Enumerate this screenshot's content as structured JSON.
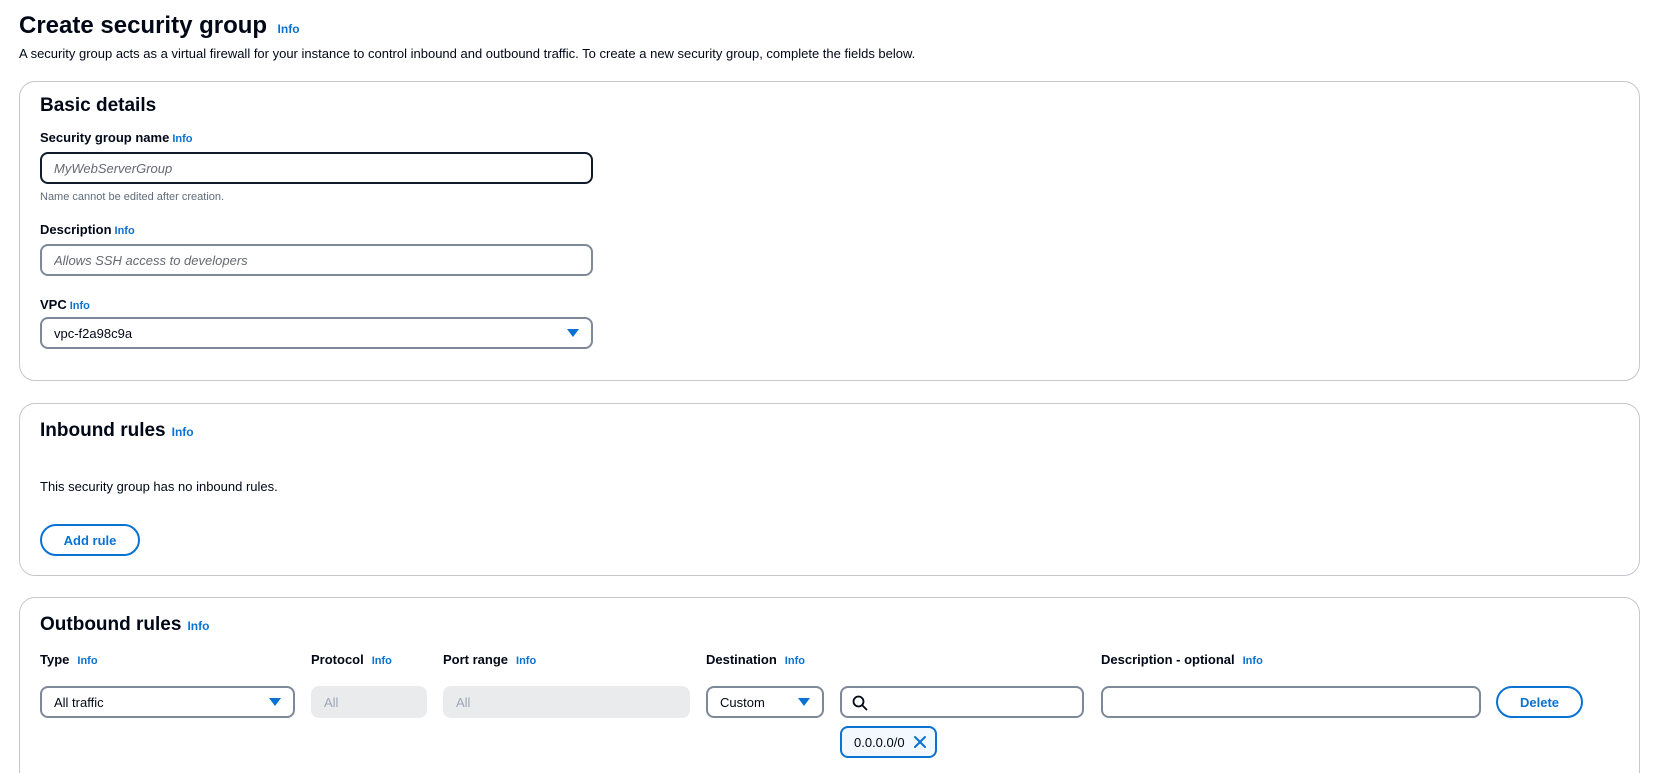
{
  "header": {
    "title": "Create security group",
    "info": "Info",
    "description": "A security group acts as a virtual firewall for your instance to control inbound and outbound traffic. To create a new security group, complete the fields below."
  },
  "basic_details": {
    "title": "Basic details",
    "name_label": "Security group name",
    "name_info": "Info",
    "name_placeholder": "MyWebServerGroup",
    "name_hint": "Name cannot be edited after creation.",
    "description_label": "Description",
    "description_info": "Info",
    "description_placeholder": "Allows SSH access to developers",
    "vpc_label": "VPC",
    "vpc_info": "Info",
    "vpc_value": "vpc-f2a98c9a"
  },
  "inbound": {
    "title": "Inbound rules",
    "info": "Info",
    "empty_text": "This security group has no inbound rules.",
    "add_rule_label": "Add rule"
  },
  "outbound": {
    "title": "Outbound rules",
    "info": "Info",
    "columns": {
      "type": "Type",
      "protocol": "Protocol",
      "port_range": "Port range",
      "destination": "Destination",
      "description": "Description - optional",
      "info": "Info"
    },
    "row": {
      "type_value": "All traffic",
      "protocol_value": "All",
      "port_range_value": "All",
      "destination_type": "Custom",
      "destination_token": "0.0.0.0/0",
      "delete_label": "Delete"
    }
  },
  "colors": {
    "accent": "#0972d3",
    "text": "#000716",
    "border": "#7d8998"
  }
}
